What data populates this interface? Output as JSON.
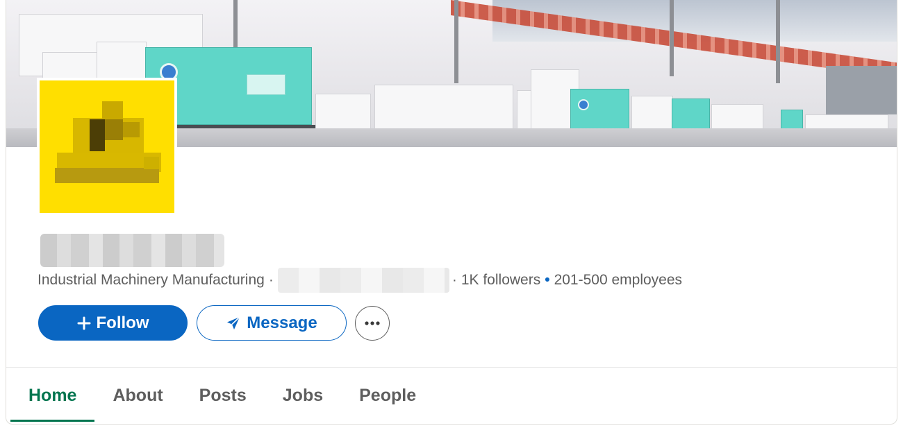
{
  "company": {
    "name": "",
    "industry": "Industrial Machinery Manufacturing",
    "separator": "·",
    "location": "",
    "followers": "1K followers",
    "bullet": "•",
    "employees": "201-500 employees"
  },
  "actions": {
    "follow_label": "Follow",
    "message_label": "Message",
    "more_label": "···"
  },
  "tabs": [
    {
      "label": "Home",
      "active": true
    },
    {
      "label": "About",
      "active": false
    },
    {
      "label": "Posts",
      "active": false
    },
    {
      "label": "Jobs",
      "active": false
    },
    {
      "label": "People",
      "active": false
    }
  ],
  "colors": {
    "primary": "#0a66c2",
    "tab_active": "#01754f",
    "logo_background": "#ffdf00"
  },
  "icons": {
    "follow": "plus-icon",
    "message": "send-icon",
    "more": "more-icon"
  }
}
